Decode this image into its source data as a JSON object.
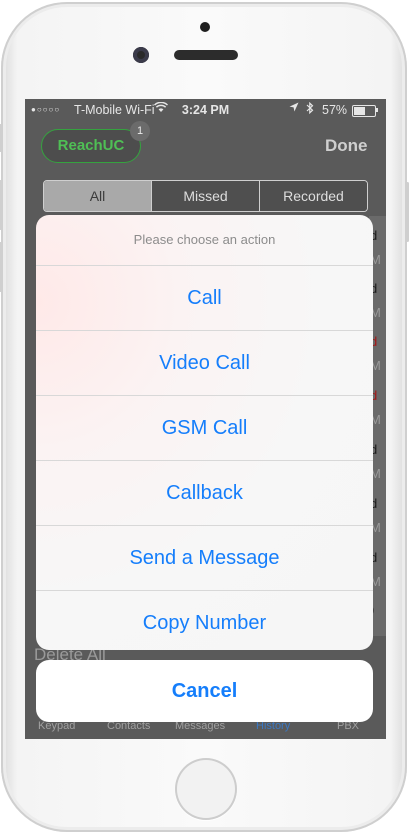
{
  "status_bar": {
    "signal_dots": "●○○○○",
    "carrier": "T-Mobile Wi-Fi",
    "time": "3:24 PM",
    "battery_percent": "57%",
    "battery_level": 0.57,
    "icons": [
      "wifi-icon",
      "location-arrow-icon",
      "bluetooth-icon",
      "battery-icon"
    ]
  },
  "nav": {
    "reach_button": "ReachUC",
    "badge_count": "1",
    "done": "Done"
  },
  "segments": [
    "All",
    "Missed",
    "Recorded"
  ],
  "selected_segment": "All",
  "background": {
    "delete_all": "Delete All",
    "tabs": [
      {
        "label": "Keypad",
        "active": false
      },
      {
        "label": "Contacts",
        "active": false
      },
      {
        "label": "Messages",
        "active": false
      },
      {
        "label": "History",
        "active": true
      },
      {
        "label": "PBX",
        "active": false
      }
    ]
  },
  "action_sheet": {
    "title": "Please choose an action",
    "items": [
      "Call",
      "Video Call",
      "GSM Call",
      "Callback",
      "Send a Message",
      "Copy Number"
    ],
    "cancel": "Cancel"
  },
  "colors": {
    "ios_blue": "#157efb",
    "reach_green": "#35a33f",
    "history_tab": "#3b78c3"
  }
}
